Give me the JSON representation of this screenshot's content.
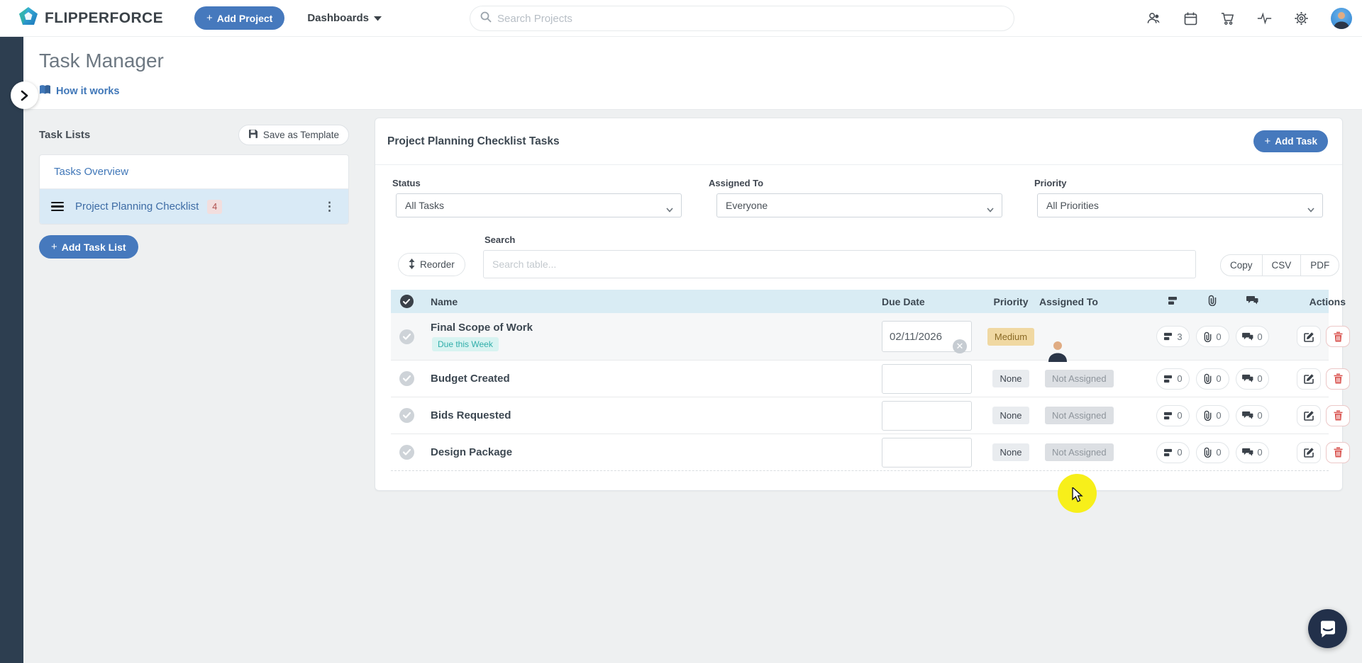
{
  "topnav": {
    "brand": "FLIPPERFORCE",
    "plus": "+",
    "add_project": "Add Project",
    "dashboards": "Dashboards",
    "search_placeholder": "Search Projects"
  },
  "page": {
    "title": "Task Manager",
    "how_it_works": "How it works"
  },
  "task_lists": {
    "title": "Task Lists",
    "save_as_template": "Save as Template",
    "overview_label": "Tasks Overview",
    "list_label": "Project Planning Checklist",
    "list_count": "4",
    "kebab": "⋮",
    "add_button": "Add Task List"
  },
  "panel": {
    "title": "Project Planning Checklist Tasks",
    "add_task": "Add Task",
    "filters": {
      "status_label": "Status",
      "status_value": "All Tasks",
      "assigned_label": "Assigned To",
      "assigned_value": "Everyone",
      "priority_label": "Priority",
      "priority_value": "All Priorities",
      "search_label": "Search",
      "search_placeholder": "Search table...",
      "reorder": "Reorder",
      "export": {
        "copy": "Copy",
        "csv": "CSV",
        "pdf": "PDF"
      }
    },
    "table": {
      "headers": {
        "name": "Name",
        "due": "Due Date",
        "priority": "Priority",
        "assigned": "Assigned To",
        "actions": "Actions"
      },
      "rows": [
        {
          "name": "Final Scope of Work",
          "due_note": "Due this Week",
          "due_value": "02/11/2026",
          "priority": "Medium",
          "subtasks": "3",
          "attachments": "0",
          "comments": "0"
        },
        {
          "name": "Budget Created",
          "priority": "None",
          "assigned": "Not Assigned",
          "subtasks": "0",
          "attachments": "0",
          "comments": "0"
        },
        {
          "name": "Bids Requested",
          "priority": "None",
          "assigned": "Not Assigned",
          "subtasks": "0",
          "attachments": "0",
          "comments": "0"
        },
        {
          "name": "Design Package",
          "priority": "None",
          "assigned": "Not Assigned",
          "subtasks": "0",
          "attachments": "0",
          "comments": "0"
        }
      ]
    }
  },
  "colors": {
    "accent_blue": "#4679bd",
    "link_blue": "#4077b8",
    "rail_navy": "#2d3e50",
    "table_header_bg": "#d9ecf4",
    "selected_row_bg": "#d9eaf6",
    "priority_medium_bg": "#f0d8a2",
    "priority_medium_text": "#8a6a25",
    "due_note_teal": "#2fada9",
    "count_badge_bg": "#f2dede",
    "count_badge_text": "#b0504e",
    "danger_red": "#d9534f",
    "highlight_yellow": "#f7ef1a"
  }
}
